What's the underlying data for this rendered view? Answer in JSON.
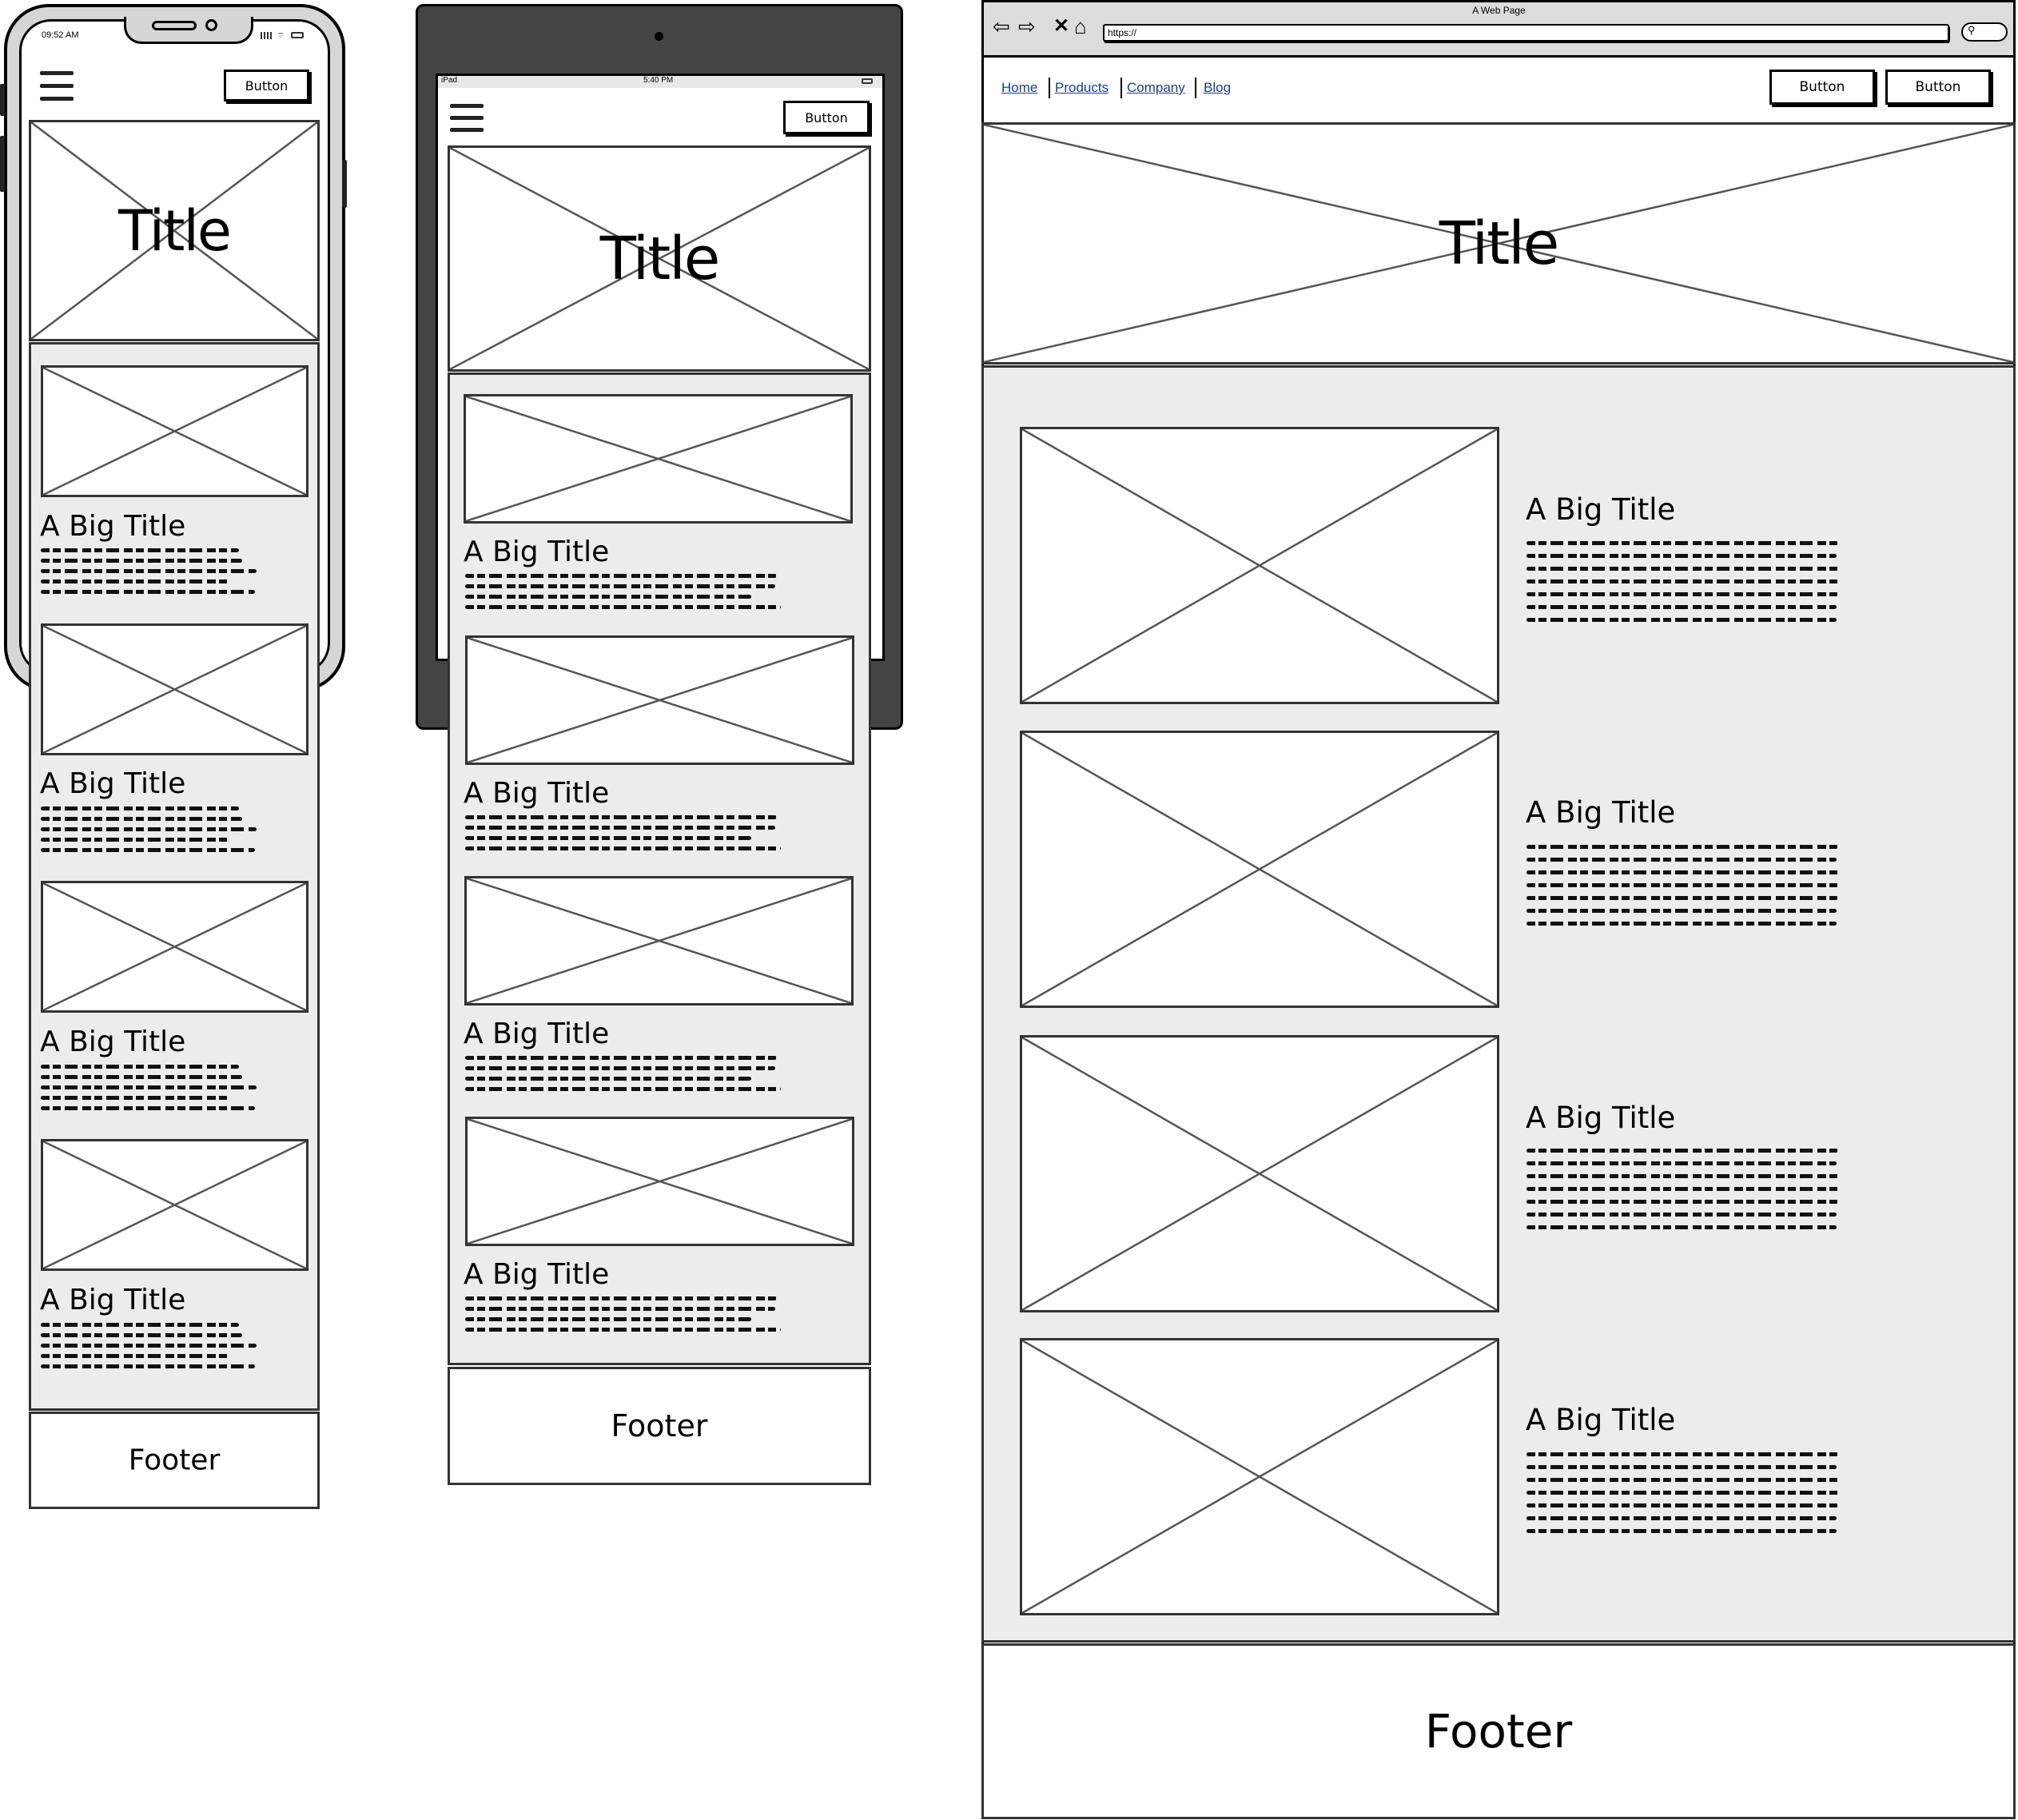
{
  "phone": {
    "time": "09:52 AM",
    "hero_title": "Title",
    "header_button": "Button",
    "cards": [
      {
        "title": "A Big Title"
      },
      {
        "title": "A Big Title"
      },
      {
        "title": "A Big Title"
      },
      {
        "title": "A Big Title"
      }
    ],
    "footer": "Footer"
  },
  "tablet": {
    "device": "iPad",
    "time": "5:40 PM",
    "hero_title": "Title",
    "header_button": "Button",
    "cards": [
      {
        "title": "A Big Title"
      },
      {
        "title": "A Big Title"
      },
      {
        "title": "A Big Title"
      }
    ],
    "footer": "Footer"
  },
  "desktop": {
    "window_title": "A Web Page",
    "url": "https://",
    "nav": [
      "Home",
      "Products",
      "Company",
      "Blog"
    ],
    "buttons": [
      "Button",
      "Button"
    ],
    "hero_title": "Title",
    "cards": [
      {
        "title": "A Big Title"
      },
      {
        "title": "A Big Title"
      },
      {
        "title": "A Big Title"
      },
      {
        "title": "A Big Title"
      }
    ],
    "footer": "Footer"
  },
  "colors": {
    "device_body": "#444444",
    "content_bg": "#ececec",
    "link": "#1a3e8c"
  }
}
